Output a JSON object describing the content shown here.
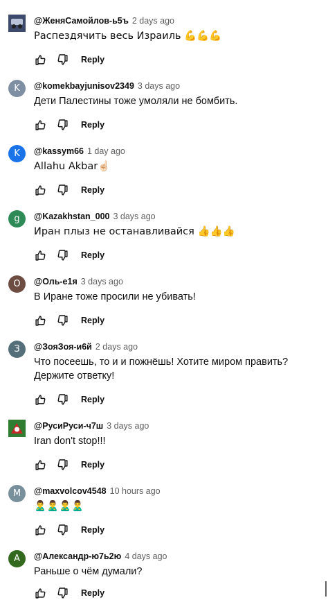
{
  "comments": [
    {
      "author": "@ЖеняСамойлов-ь5ъ",
      "time": "2 days ago",
      "text": "Распездячить весь Израиль 💪💪💪",
      "avatar": {
        "type": "image"
      },
      "reply_label": "Reply"
    },
    {
      "author": "@komekbayjunisov2349",
      "time": "3 days ago",
      "text": "Дети Палестины тоже умоляли не бомбить.",
      "avatar": {
        "type": "letter",
        "letter": "K",
        "color": "#7e8fa3"
      },
      "reply_label": "Reply"
    },
    {
      "author": "@kassym66",
      "time": "1 day ago",
      "text": "Allahu Akbar☝🏻",
      "avatar": {
        "type": "letter",
        "letter": "K",
        "color": "#1a73e8"
      },
      "reply_label": "Reply"
    },
    {
      "author": "@Kazakhstan_000",
      "time": "3 days ago",
      "text": "Иран плыз не останавливайся 👍👍👍",
      "avatar": {
        "type": "letter",
        "letter": "g",
        "color": "#2e8b57"
      },
      "reply_label": "Reply"
    },
    {
      "author": "@Оль-е1я",
      "time": "3 days ago",
      "text": "В Иране тоже просили не убивать!",
      "avatar": {
        "type": "letter",
        "letter": "О",
        "color": "#6d4c41"
      },
      "reply_label": "Reply"
    },
    {
      "author": "@ЗояЗоя-и6й",
      "time": "2 days ago",
      "text": "Что посеешь, то и и пожнёшь! Хотите миром править? Держите ответку!",
      "avatar": {
        "type": "letter",
        "letter": "З",
        "color": "#546e7a"
      },
      "reply_label": "Reply"
    },
    {
      "author": "@РусиРуси-ч7ш",
      "time": "3 days ago",
      "text": "Iran don't stop!!!",
      "avatar": {
        "type": "image"
      },
      "reply_label": "Reply"
    },
    {
      "author": "@maxvolcov4548",
      "time": "10 hours ago",
      "text": "🙎‍♂️🙎‍♂️🙎‍♂️🙎‍♂️",
      "avatar": {
        "type": "letter",
        "letter": "M",
        "color": "#78909c"
      },
      "reply_label": "Reply"
    },
    {
      "author": "@Александр-ю7ь2ю",
      "time": "4 days ago",
      "text": "Раньше о чём думали?",
      "avatar": {
        "type": "letter",
        "letter": "A",
        "color": "#33691e"
      },
      "reply_label": "Reply"
    }
  ]
}
